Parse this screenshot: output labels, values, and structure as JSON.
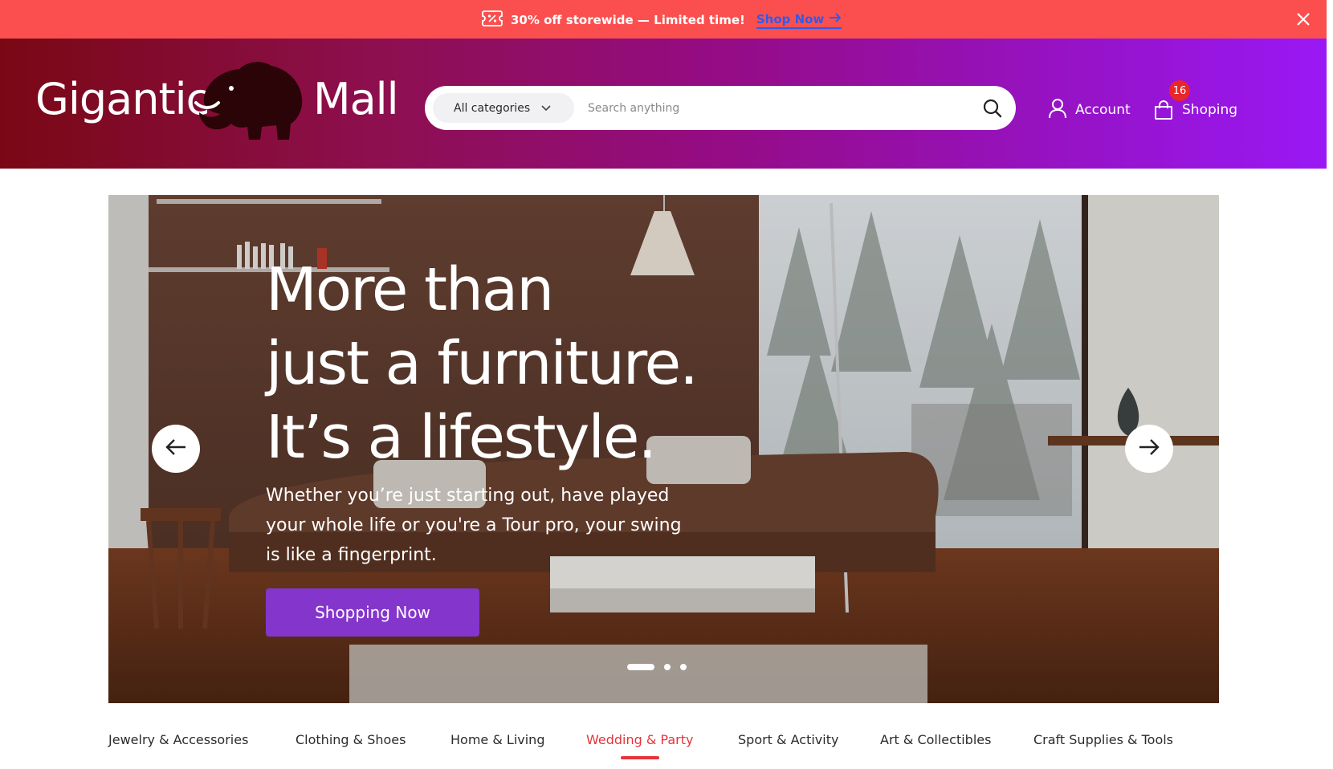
{
  "promo": {
    "text": "30% off storewide — Limited time!",
    "link_label": "Shop Now",
    "icon": "discount-ticket-icon"
  },
  "header": {
    "logo": {
      "left": "Gigantic",
      "right": "Mall"
    },
    "search": {
      "category_label": "All categories",
      "placeholder": "Search anything"
    },
    "account_label": "Account",
    "cart_label": "Shoping",
    "cart_count": "16"
  },
  "hero": {
    "title_lines": [
      "More than",
      "just a furniture.",
      "It’s a lifestyle."
    ],
    "subtitle": "Whether you’re just starting out, have played your whole life or you're a Tour pro, your swing is like a fingerprint.",
    "cta_label": "Shopping Now",
    "slide_count": 3,
    "active_slide": 1
  },
  "categories": {
    "items": [
      "Jewelry & Accessories",
      "Clothing & Shoes",
      "Home & Living",
      "Wedding & Party",
      "Sport & Activity",
      "Art & Collectibles",
      "Craft Supplies & Tools"
    ],
    "active": "Wedding & Party"
  },
  "colors": {
    "promo_bg": "#fb4f4f",
    "header_gradient_start": "#7a0814",
    "header_gradient_end": "#9a18f5",
    "accent_purple": "#8435cc",
    "active_red": "#e8323a"
  }
}
